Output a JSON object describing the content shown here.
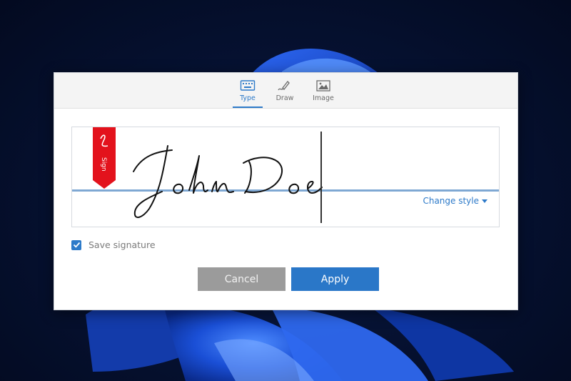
{
  "tabs": [
    {
      "label": "Type",
      "icon": "keyboard-icon",
      "active": true
    },
    {
      "label": "Draw",
      "icon": "pen-draw-icon",
      "active": false
    },
    {
      "label": "Image",
      "icon": "image-icon",
      "active": false
    }
  ],
  "signature": {
    "text": "John Doe",
    "flag_label": "Sign",
    "change_style_label": "Change style"
  },
  "save_signature": {
    "label": "Save signature",
    "checked": true
  },
  "buttons": {
    "cancel": "Cancel",
    "apply": "Apply"
  },
  "colors": {
    "accent": "#2d7ac9",
    "flag_red": "#e3121c",
    "cancel_gray": "#9b9b9b",
    "apply_blue": "#2a77c8"
  }
}
